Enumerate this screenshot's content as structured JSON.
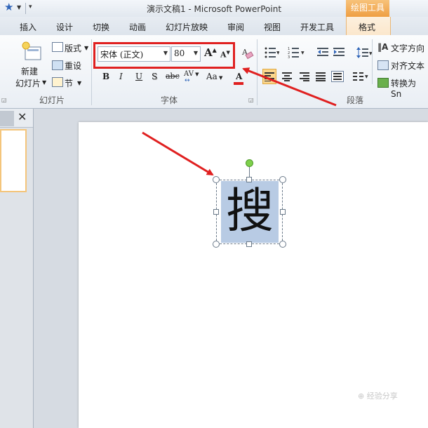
{
  "window": {
    "title": "演示文稿1  -  Microsoft PowerPoint",
    "contextual_tab_header": "绘图工具"
  },
  "tabs": [
    "插入",
    "设计",
    "切换",
    "动画",
    "幻灯片放映",
    "审阅",
    "视图",
    "开发工具",
    "格式"
  ],
  "ribbon": {
    "slides_group": {
      "label": "幻灯片",
      "new_slide_line1": "新建",
      "new_slide_line2": "幻灯片",
      "layout": "版式",
      "reset": "重设",
      "section": "节"
    },
    "font_group": {
      "label": "字体",
      "font_name": "宋体 (正文)",
      "font_size": "80",
      "grow_font": "A",
      "shrink_font": "A",
      "bold": "B",
      "italic": "I",
      "underline": "U",
      "shadow": "S",
      "strikethrough": "abc",
      "char_spacing": "AV",
      "change_case": "Aa",
      "font_color": "A"
    },
    "paragraph_group": {
      "label": "段落",
      "text_direction": "文字方向",
      "align_text": "对齐文本",
      "convert_smartart": "转换为 Sn"
    }
  },
  "slide": {
    "text_box_char": "搜"
  },
  "watermark": "⊕ 经验分享",
  "colors": {
    "accent_orange": "#ef9f43",
    "highlight_red": "#e02020",
    "selection_fill": "#b8cbe4"
  }
}
